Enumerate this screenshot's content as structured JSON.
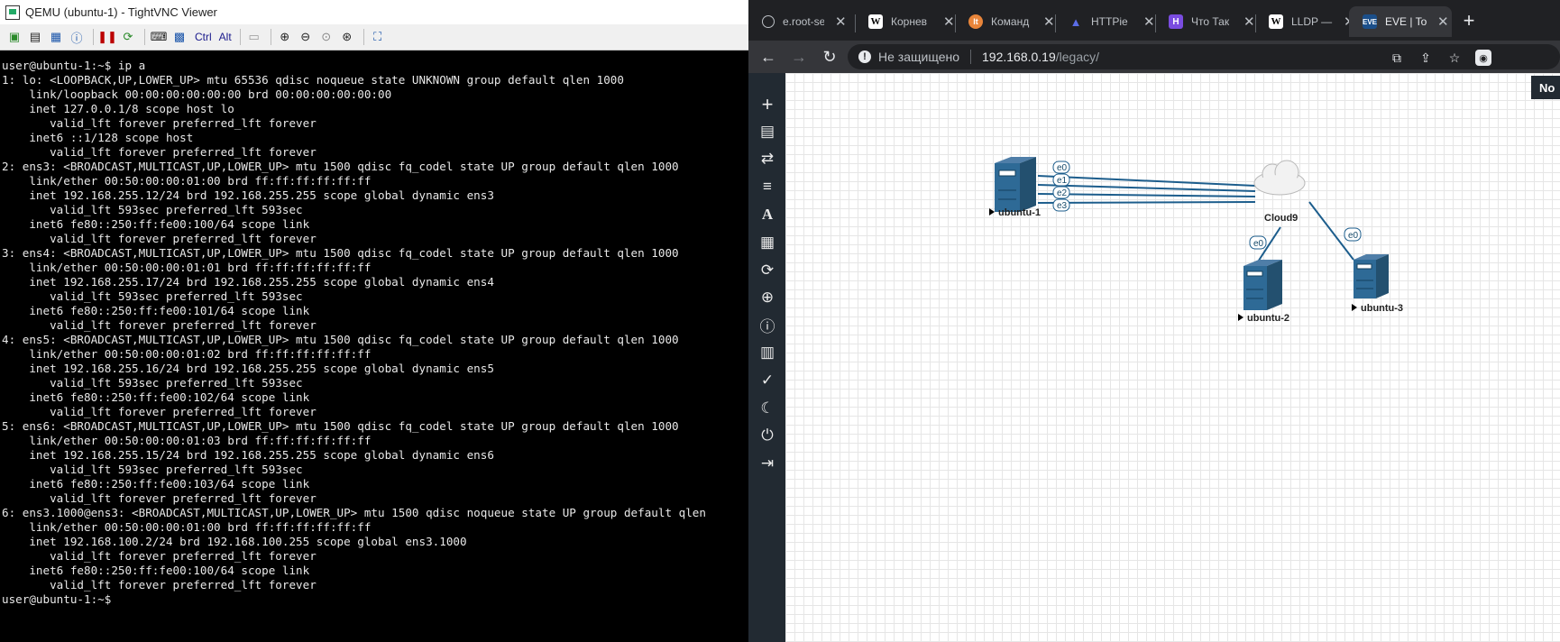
{
  "vnc": {
    "title": "QEMU (ubuntu-1) - TightVNC Viewer",
    "toolbar": {
      "ctrl_label": "Ctrl",
      "alt_label": "Alt"
    },
    "terminal_lines": [
      "user@ubuntu-1:~$ ip a",
      "1: lo: <LOOPBACK,UP,LOWER_UP> mtu 65536 qdisc noqueue state UNKNOWN group default qlen 1000",
      "    link/loopback 00:00:00:00:00:00 brd 00:00:00:00:00:00",
      "    inet 127.0.0.1/8 scope host lo",
      "       valid_lft forever preferred_lft forever",
      "    inet6 ::1/128 scope host",
      "       valid_lft forever preferred_lft forever",
      "2: ens3: <BROADCAST,MULTICAST,UP,LOWER_UP> mtu 1500 qdisc fq_codel state UP group default qlen 1000",
      "    link/ether 00:50:00:00:01:00 brd ff:ff:ff:ff:ff:ff",
      "    inet 192.168.255.12/24 brd 192.168.255.255 scope global dynamic ens3",
      "       valid_lft 593sec preferred_lft 593sec",
      "    inet6 fe80::250:ff:fe00:100/64 scope link",
      "       valid_lft forever preferred_lft forever",
      "3: ens4: <BROADCAST,MULTICAST,UP,LOWER_UP> mtu 1500 qdisc fq_codel state UP group default qlen 1000",
      "    link/ether 00:50:00:00:01:01 brd ff:ff:ff:ff:ff:ff",
      "    inet 192.168.255.17/24 brd 192.168.255.255 scope global dynamic ens4",
      "       valid_lft 593sec preferred_lft 593sec",
      "    inet6 fe80::250:ff:fe00:101/64 scope link",
      "       valid_lft forever preferred_lft forever",
      "4: ens5: <BROADCAST,MULTICAST,UP,LOWER_UP> mtu 1500 qdisc fq_codel state UP group default qlen 1000",
      "    link/ether 00:50:00:00:01:02 brd ff:ff:ff:ff:ff:ff",
      "    inet 192.168.255.16/24 brd 192.168.255.255 scope global dynamic ens5",
      "       valid_lft 593sec preferred_lft 593sec",
      "    inet6 fe80::250:ff:fe00:102/64 scope link",
      "       valid_lft forever preferred_lft forever",
      "5: ens6: <BROADCAST,MULTICAST,UP,LOWER_UP> mtu 1500 qdisc fq_codel state UP group default qlen 1000",
      "    link/ether 00:50:00:00:01:03 brd ff:ff:ff:ff:ff:ff",
      "    inet 192.168.255.15/24 brd 192.168.255.255 scope global dynamic ens6",
      "       valid_lft 593sec preferred_lft 593sec",
      "    inet6 fe80::250:ff:fe00:103/64 scope link",
      "       valid_lft forever preferred_lft forever",
      "6: ens3.1000@ens3: <BROADCAST,MULTICAST,UP,LOWER_UP> mtu 1500 qdisc noqueue state UP group default qlen",
      "    link/ether 00:50:00:00:01:00 brd ff:ff:ff:ff:ff:ff",
      "    inet 192.168.100.2/24 brd 192.168.100.255 scope global ens3.1000",
      "       valid_lft forever preferred_lft forever",
      "    inet6 fe80::250:ff:fe00:100/64 scope link",
      "       valid_lft forever preferred_lft forever",
      "user@ubuntu-1:~$"
    ]
  },
  "browser": {
    "tabs": [
      {
        "title": "e.root-se",
        "icon": "globe-icon",
        "active": false
      },
      {
        "title": "Корнев",
        "icon": "wikipedia-icon",
        "active": false
      },
      {
        "title": "Команд",
        "icon": "lt-icon",
        "active": false
      },
      {
        "title": "HTTPie",
        "icon": "httpie-icon",
        "active": false
      },
      {
        "title": "Что Так",
        "icon": "h-icon",
        "active": false
      },
      {
        "title": "LLDP —",
        "icon": "wikipedia-icon",
        "active": false
      },
      {
        "title": "EVE | To",
        "icon": "eve-icon",
        "active": true
      }
    ],
    "address": {
      "security_text": "Не защищено",
      "host": "192.168.0.19",
      "path": "/legacy/"
    },
    "notification_text": "No"
  },
  "topology": {
    "nodes": [
      "ubuntu-1",
      "ubuntu-2",
      "ubuntu-3"
    ],
    "cloud": "Cloud9",
    "ports_ubuntu1": [
      "e0",
      "e1",
      "e2",
      "e3"
    ],
    "port_ubuntu2": "e0",
    "port_ubuntu3": "e0"
  },
  "colors": {
    "link": "#1c5d8c",
    "eve_sidebar": "#222a32",
    "chrome_tabbar": "#202124",
    "chrome_toolbar": "#35363a"
  }
}
